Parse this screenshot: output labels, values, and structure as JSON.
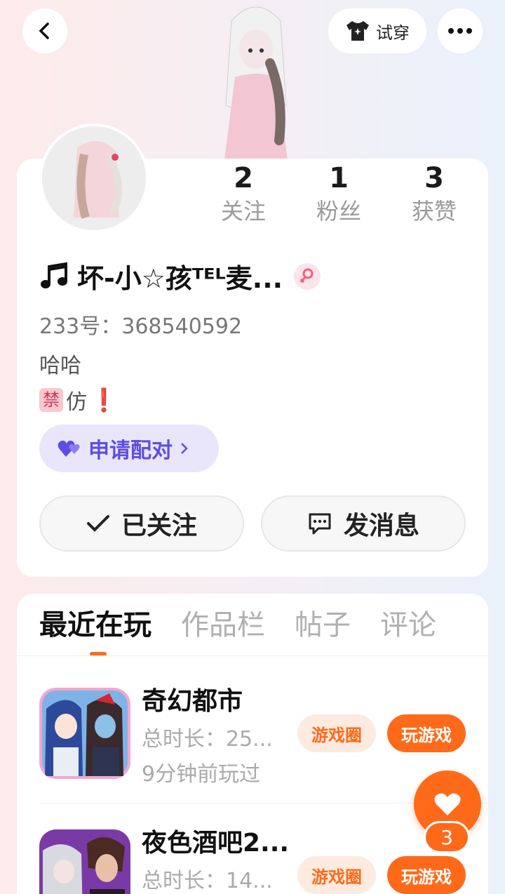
{
  "header": {
    "try_on_label": "试穿"
  },
  "profile": {
    "stats": [
      {
        "value": "2",
        "label": "关注"
      },
      {
        "value": "1",
        "label": "粉丝"
      },
      {
        "value": "3",
        "label": "获赞"
      }
    ],
    "name": "坏-小☆孩ᵀᴱᴸ麦...",
    "id_text": "233号：368540592",
    "bio_line1": "哈哈",
    "bio_line2_char": "仿",
    "bio_ban_badge": "禁",
    "bio_mark": "❗",
    "pair_label": "申请配对",
    "follow_label": "已关注",
    "message_label": "发消息"
  },
  "tabs": [
    {
      "label": "最近在玩"
    },
    {
      "label": "作品栏"
    },
    {
      "label": "帖子"
    },
    {
      "label": "评论"
    }
  ],
  "games": [
    {
      "name": "奇幻都市",
      "time": "总时长：25...",
      "last": "9分钟前玩过",
      "circle_label": "游戏圈",
      "play_label": "玩游戏"
    },
    {
      "name": "夜色酒吧2...",
      "time": "总时长：14...",
      "circle_label": "游戏圈",
      "play_label": "玩游戏"
    }
  ],
  "fab": {
    "count": "3"
  },
  "colors": {
    "accent": "#ff6a1a",
    "pair": "#5d4de0"
  }
}
